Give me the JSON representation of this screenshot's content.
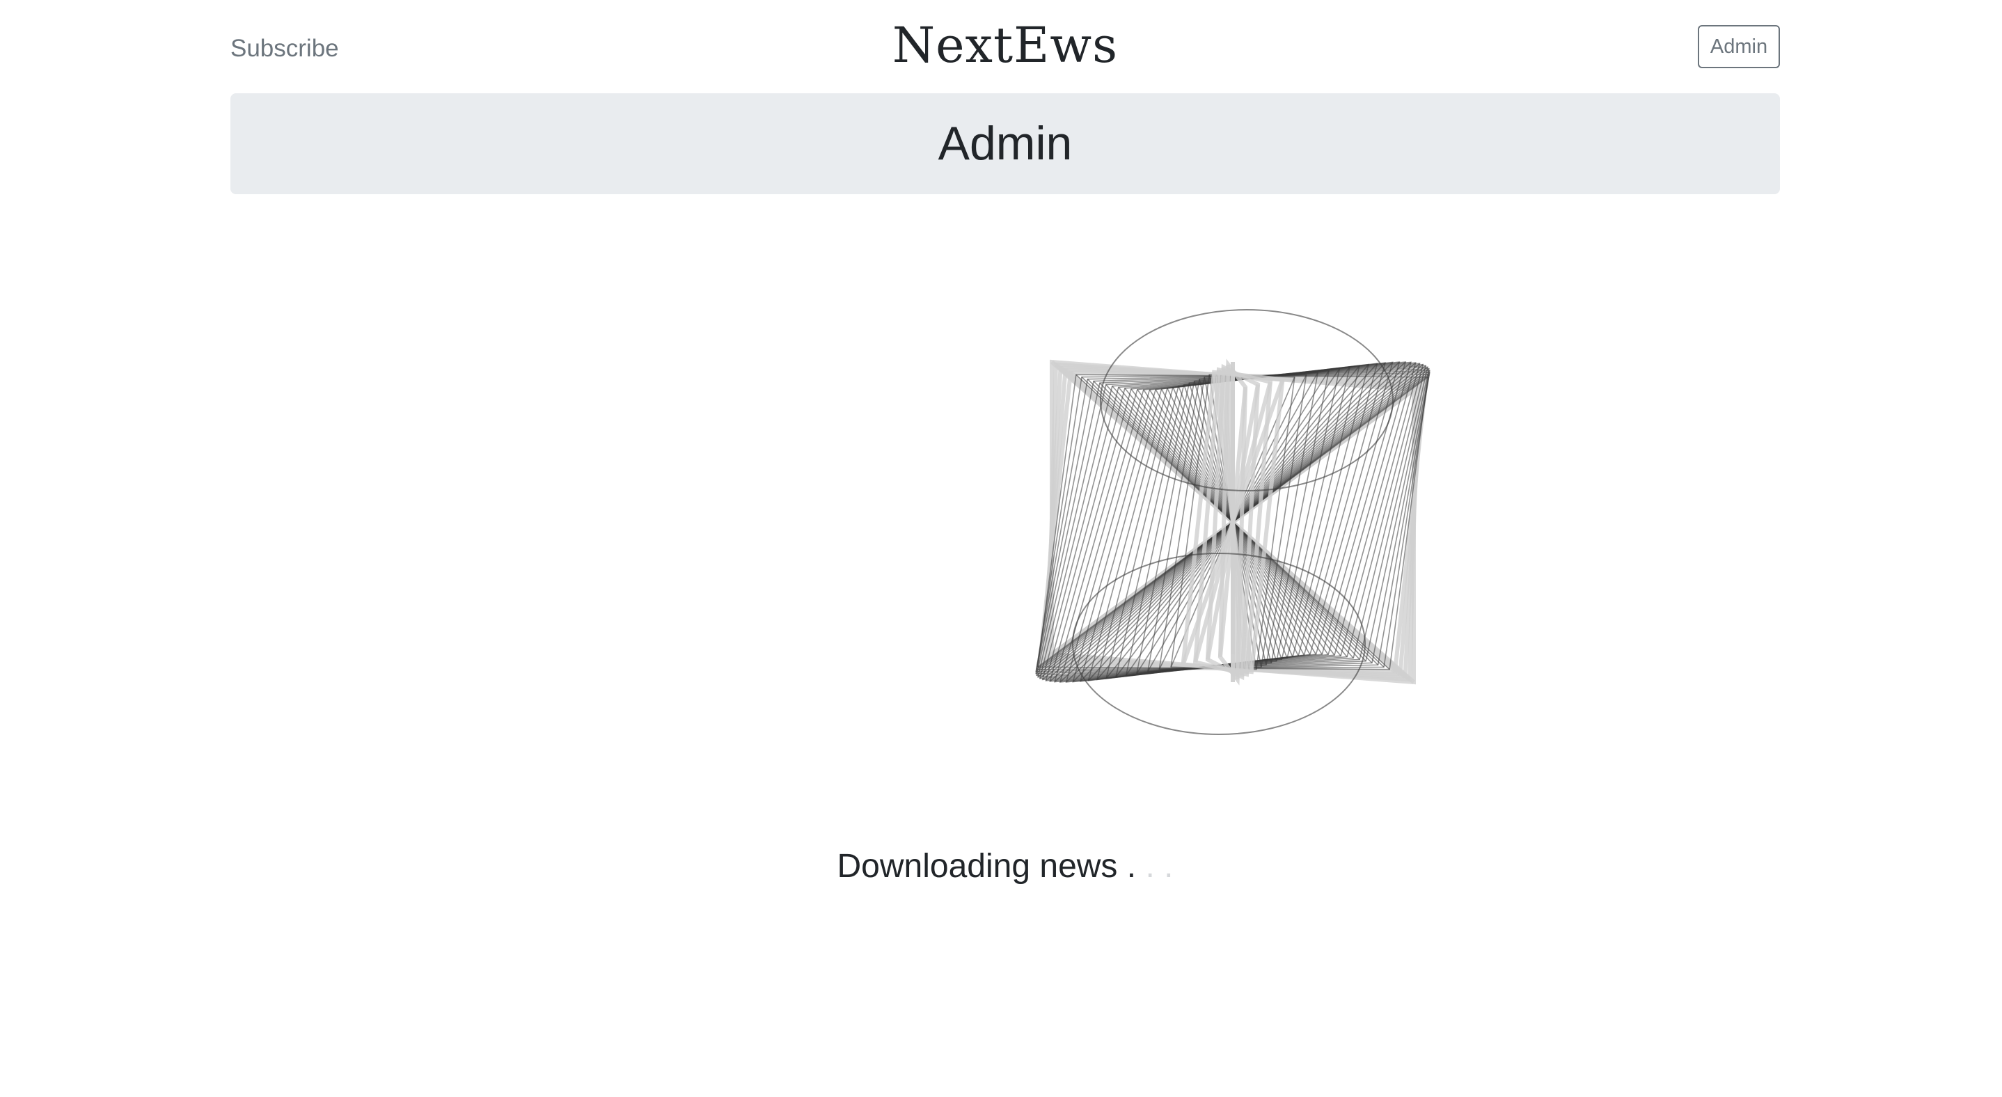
{
  "header": {
    "subscribe_label": "Subscribe",
    "brand": "NextEws",
    "admin_button_label": "Admin"
  },
  "jumbotron": {
    "title": "Admin"
  },
  "loading": {
    "message": "Downloading news",
    "dots": [
      ".",
      ".",
      "."
    ],
    "spinner_icon": "wireframe-spinner-icon"
  },
  "colors": {
    "jumbotron_bg": "#e9ecef",
    "text": "#212529",
    "muted": "#6c757d",
    "loader_stroke": "#3a3a3a"
  }
}
